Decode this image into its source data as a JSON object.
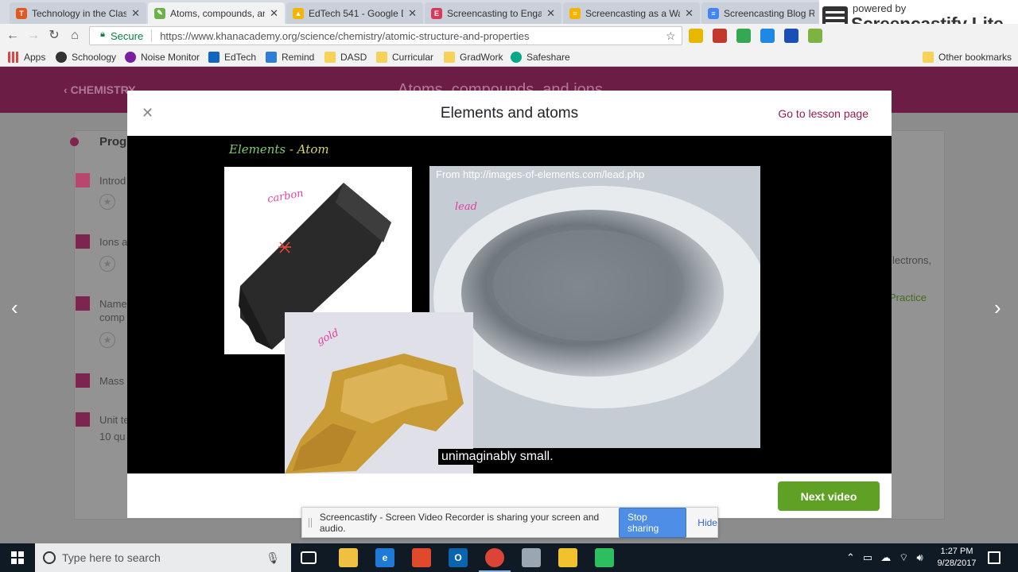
{
  "browser": {
    "tabs": [
      {
        "title": "Technology in the Class",
        "fav_color": "#e25822",
        "fav_glyph": "T"
      },
      {
        "title": "Atoms, compounds, an",
        "fav_color": "#6bb24a",
        "fav_glyph": "✎"
      },
      {
        "title": "EdTech 541 - Google Dr",
        "fav_color": "#f4b400",
        "fav_glyph": "▲"
      },
      {
        "title": "Screencasting to Engag",
        "fav_color": "#d93a59",
        "fav_glyph": "E"
      },
      {
        "title": "Screencasting as a Way",
        "fav_color": "#f4b400",
        "fav_glyph": "≡"
      },
      {
        "title": "Screencasting Blog Refl",
        "fav_color": "#4285f4",
        "fav_glyph": "≡"
      }
    ],
    "secure_label": "Secure",
    "url": "https://www.khanacademy.org/science/chemistry/atomic-structure-and-properties",
    "bookmarks": [
      {
        "label": "Apps",
        "icon": "apps-grid-icon"
      },
      {
        "label": "Schoology",
        "icon": "schoology-icon"
      },
      {
        "label": "Noise Monitor",
        "icon": "noise-monitor-icon"
      },
      {
        "label": "EdTech",
        "icon": "edtech-icon"
      },
      {
        "label": "Remind",
        "icon": "remind-icon"
      },
      {
        "label": "DASD",
        "icon": "folder-icon"
      },
      {
        "label": "Curricular",
        "icon": "folder-icon"
      },
      {
        "label": "GradWork",
        "icon": "folder-icon"
      },
      {
        "label": "Safeshare",
        "icon": "safeshare-icon"
      }
    ],
    "other_bookmarks": "Other bookmarks"
  },
  "screencastify_badge": {
    "powered_by": "powered by",
    "name": "Screencastify Lite"
  },
  "page": {
    "back_link": "CHEMISTRY",
    "course_title": "Atoms, compounds, and ions",
    "progress_label": "Prog",
    "items": [
      {
        "label": "Introd"
      },
      {
        "label": "Ions a"
      },
      {
        "label": "Name",
        "sub": "comp"
      },
      {
        "label": "Mass"
      },
      {
        "label": "Unit te",
        "sub": "10 qu"
      }
    ],
    "right_text": "lectrons,",
    "practice": "Practice"
  },
  "modal": {
    "title": "Elements and atoms",
    "go_to_lesson": "Go to lesson page",
    "next_video": "Next video",
    "video": {
      "board_title": "Elements",
      "board_title_suffix": "- Atom",
      "source": "From http://images-of-elements.com/lead.php",
      "annotations": {
        "carbon": "carbon",
        "lead": "lead",
        "gold": "gold"
      },
      "caption": "unimaginably small."
    }
  },
  "share_notice": {
    "message": "Screencastify - Screen Video Recorder is sharing your screen and audio.",
    "stop_label": "Stop sharing",
    "hide_label": "Hide"
  },
  "taskbar": {
    "search_placeholder": "Type here to search",
    "time": "1:27 PM",
    "date": "9/28/2017"
  }
}
